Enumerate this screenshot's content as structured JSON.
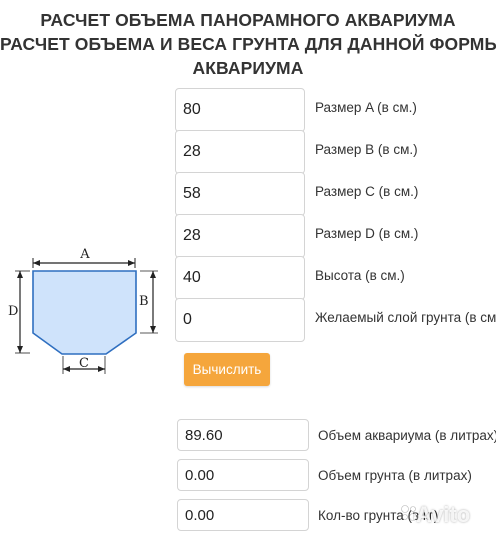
{
  "title": {
    "line1": "РАСЧЕТ ОБЪЕМА ПАНОРАМНОГО АКВАРИУМА",
    "line2": "РАСЧЕТ ОБЪЕМА И ВЕСА ГРУНТА ДЛЯ ДАННОЙ ФОРМЫ",
    "line3": "АКВАРИУМА"
  },
  "inputs": {
    "size_a": {
      "value": "80",
      "label": "Размер A (в см.)"
    },
    "size_b": {
      "value": "28",
      "label": "Размер B (в см.)"
    },
    "size_c": {
      "value": "58",
      "label": "Размер C (в см.)"
    },
    "size_d": {
      "value": "28",
      "label": "Размер D (в см.)"
    },
    "height": {
      "value": "40",
      "label": "Высота (в см.)"
    },
    "soil_layer": {
      "value": "0",
      "label": "Желаемый слой грунта (в см.)"
    }
  },
  "calculate_label": "Вычислить",
  "results": {
    "aquarium_volume": {
      "value": "89.60",
      "label": "Объем аквариума (в литрах)"
    },
    "soil_volume": {
      "value": "0.00",
      "label": "Объем грунта (в литрах)"
    },
    "soil_weight": {
      "value": "0.00",
      "label": "Кол-во грунта (в кг)"
    }
  },
  "diagram": {
    "label_a": "A",
    "label_b": "B",
    "label_c": "C",
    "label_d": "D",
    "fill_color": "#cfe3fb",
    "stroke_color": "#2f6fc0"
  },
  "watermark": {
    "text": "Avito"
  }
}
